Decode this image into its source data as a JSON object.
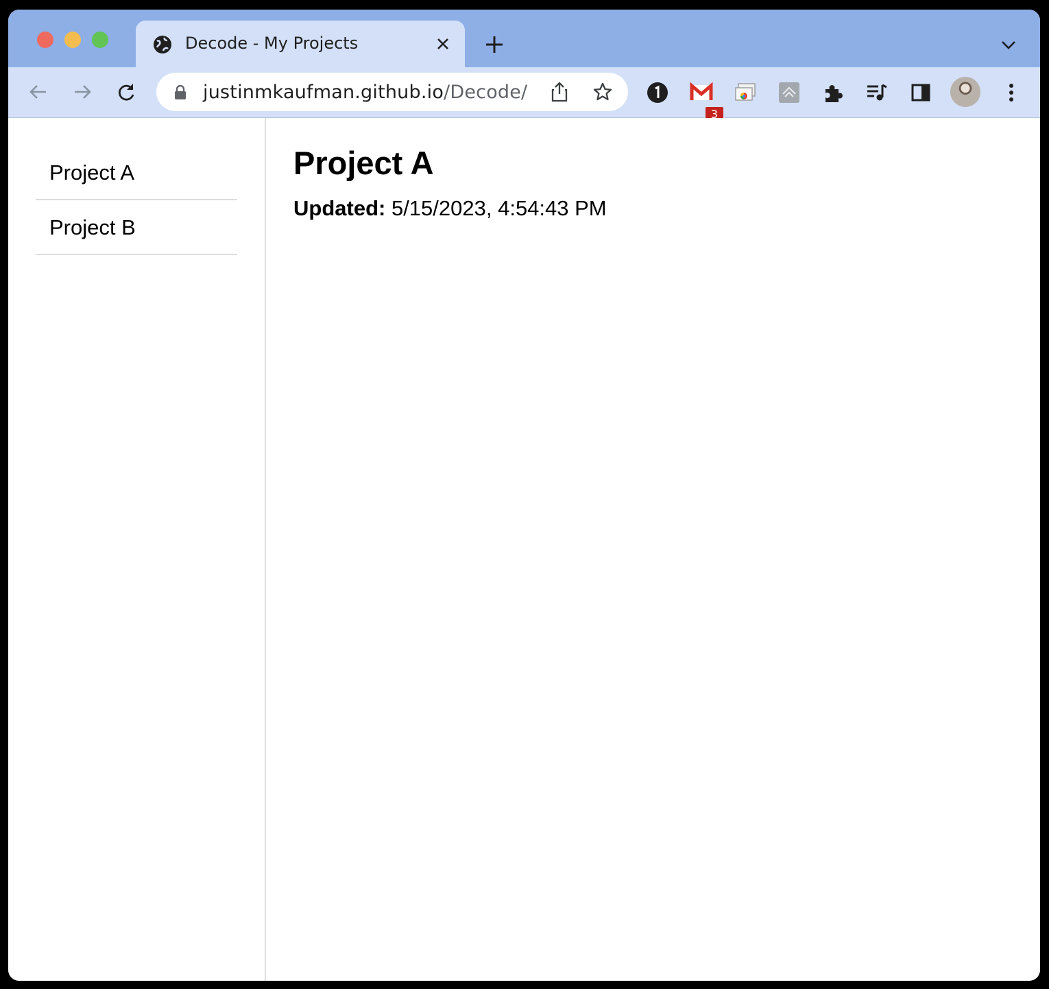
{
  "browser": {
    "tab": {
      "title": "Decode - My Projects",
      "favicon": "globe-icon"
    },
    "address_bar": {
      "domain": "justinmkaufman.github.io",
      "path": "/Decode/",
      "secure_icon": "lock-icon"
    },
    "extensions": [
      {
        "name": "1password-icon"
      },
      {
        "name": "gmail-checker-icon",
        "badge": "3"
      },
      {
        "name": "cast-tab-icon"
      },
      {
        "name": "toggl-extension-icon"
      },
      {
        "name": "extensions-puzzle-icon"
      },
      {
        "name": "media-controls-icon"
      },
      {
        "name": "side-panel-icon"
      }
    ],
    "profile": "avatar"
  },
  "sidebar": {
    "items": [
      {
        "label": "Project A"
      },
      {
        "label": "Project B"
      }
    ]
  },
  "main": {
    "title": "Project A",
    "updated_label": "Updated:",
    "updated_value": "5/15/2023, 4:54:43 PM"
  }
}
